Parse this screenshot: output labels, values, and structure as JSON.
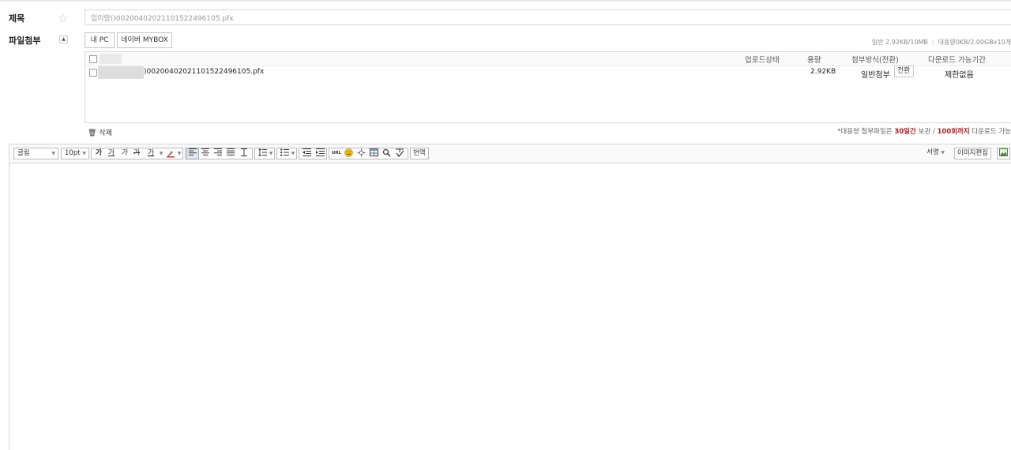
{
  "subject": {
    "label": "제목",
    "value": "입이랑()0020040202110152249​6105.pfx"
  },
  "attach": {
    "label": "파일첨부",
    "my_pc_label": "내 PC",
    "mybox_label": "네이버 MYBOX",
    "quota_general": "일반 2.92KB/10MB",
    "quota_large": "대용량0KB/2.00GBx10개",
    "columns": {
      "status": "업로드상태",
      "size": "용량",
      "method": "첨부방식(전환)",
      "period": "다운로드 가능기간"
    },
    "files": [
      {
        "name": ")0020040202110152249​6105.pfx",
        "size": "2.92KB",
        "method": "일반첨부",
        "convert_label": "전환",
        "period": "제한없음"
      }
    ],
    "delete_label": "삭제",
    "notice": {
      "prefix": "*대용량 첨부파일은 ",
      "days": "30일간",
      "mid": " 보관 / ",
      "count": "100회까지",
      "suffix": " 다운로드 가능"
    }
  },
  "editor": {
    "font_label": "굴림",
    "size_label": "10pt",
    "translate_label": "번역",
    "signature_label": "서명",
    "image_edit_label": "이미지편집",
    "url_label": "URL",
    "format": {
      "bold": "가",
      "underline": "가",
      "italic": "가",
      "strike": "가",
      "color": "가"
    }
  },
  "colors": {
    "notice_red": "#b02020",
    "border": "#d7d7d7"
  }
}
